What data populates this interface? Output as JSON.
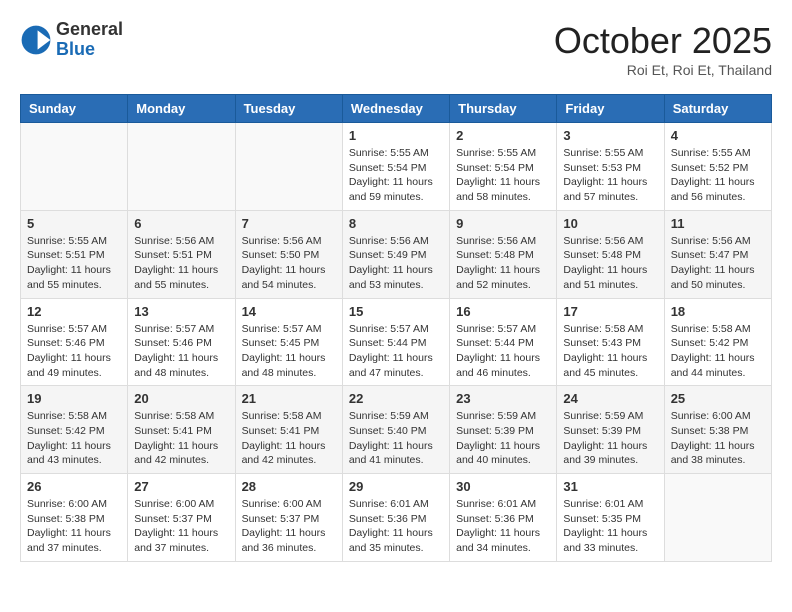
{
  "header": {
    "logo_general": "General",
    "logo_blue": "Blue",
    "month_title": "October 2025",
    "location": "Roi Et, Roi Et, Thailand"
  },
  "weekdays": [
    "Sunday",
    "Monday",
    "Tuesday",
    "Wednesday",
    "Thursday",
    "Friday",
    "Saturday"
  ],
  "weeks": [
    [
      {
        "day": "",
        "info": ""
      },
      {
        "day": "",
        "info": ""
      },
      {
        "day": "",
        "info": ""
      },
      {
        "day": "1",
        "info": "Sunrise: 5:55 AM\nSunset: 5:54 PM\nDaylight: 11 hours\nand 59 minutes."
      },
      {
        "day": "2",
        "info": "Sunrise: 5:55 AM\nSunset: 5:54 PM\nDaylight: 11 hours\nand 58 minutes."
      },
      {
        "day": "3",
        "info": "Sunrise: 5:55 AM\nSunset: 5:53 PM\nDaylight: 11 hours\nand 57 minutes."
      },
      {
        "day": "4",
        "info": "Sunrise: 5:55 AM\nSunset: 5:52 PM\nDaylight: 11 hours\nand 56 minutes."
      }
    ],
    [
      {
        "day": "5",
        "info": "Sunrise: 5:55 AM\nSunset: 5:51 PM\nDaylight: 11 hours\nand 55 minutes."
      },
      {
        "day": "6",
        "info": "Sunrise: 5:56 AM\nSunset: 5:51 PM\nDaylight: 11 hours\nand 55 minutes."
      },
      {
        "day": "7",
        "info": "Sunrise: 5:56 AM\nSunset: 5:50 PM\nDaylight: 11 hours\nand 54 minutes."
      },
      {
        "day": "8",
        "info": "Sunrise: 5:56 AM\nSunset: 5:49 PM\nDaylight: 11 hours\nand 53 minutes."
      },
      {
        "day": "9",
        "info": "Sunrise: 5:56 AM\nSunset: 5:48 PM\nDaylight: 11 hours\nand 52 minutes."
      },
      {
        "day": "10",
        "info": "Sunrise: 5:56 AM\nSunset: 5:48 PM\nDaylight: 11 hours\nand 51 minutes."
      },
      {
        "day": "11",
        "info": "Sunrise: 5:56 AM\nSunset: 5:47 PM\nDaylight: 11 hours\nand 50 minutes."
      }
    ],
    [
      {
        "day": "12",
        "info": "Sunrise: 5:57 AM\nSunset: 5:46 PM\nDaylight: 11 hours\nand 49 minutes."
      },
      {
        "day": "13",
        "info": "Sunrise: 5:57 AM\nSunset: 5:46 PM\nDaylight: 11 hours\nand 48 minutes."
      },
      {
        "day": "14",
        "info": "Sunrise: 5:57 AM\nSunset: 5:45 PM\nDaylight: 11 hours\nand 48 minutes."
      },
      {
        "day": "15",
        "info": "Sunrise: 5:57 AM\nSunset: 5:44 PM\nDaylight: 11 hours\nand 47 minutes."
      },
      {
        "day": "16",
        "info": "Sunrise: 5:57 AM\nSunset: 5:44 PM\nDaylight: 11 hours\nand 46 minutes."
      },
      {
        "day": "17",
        "info": "Sunrise: 5:58 AM\nSunset: 5:43 PM\nDaylight: 11 hours\nand 45 minutes."
      },
      {
        "day": "18",
        "info": "Sunrise: 5:58 AM\nSunset: 5:42 PM\nDaylight: 11 hours\nand 44 minutes."
      }
    ],
    [
      {
        "day": "19",
        "info": "Sunrise: 5:58 AM\nSunset: 5:42 PM\nDaylight: 11 hours\nand 43 minutes."
      },
      {
        "day": "20",
        "info": "Sunrise: 5:58 AM\nSunset: 5:41 PM\nDaylight: 11 hours\nand 42 minutes."
      },
      {
        "day": "21",
        "info": "Sunrise: 5:58 AM\nSunset: 5:41 PM\nDaylight: 11 hours\nand 42 minutes."
      },
      {
        "day": "22",
        "info": "Sunrise: 5:59 AM\nSunset: 5:40 PM\nDaylight: 11 hours\nand 41 minutes."
      },
      {
        "day": "23",
        "info": "Sunrise: 5:59 AM\nSunset: 5:39 PM\nDaylight: 11 hours\nand 40 minutes."
      },
      {
        "day": "24",
        "info": "Sunrise: 5:59 AM\nSunset: 5:39 PM\nDaylight: 11 hours\nand 39 minutes."
      },
      {
        "day": "25",
        "info": "Sunrise: 6:00 AM\nSunset: 5:38 PM\nDaylight: 11 hours\nand 38 minutes."
      }
    ],
    [
      {
        "day": "26",
        "info": "Sunrise: 6:00 AM\nSunset: 5:38 PM\nDaylight: 11 hours\nand 37 minutes."
      },
      {
        "day": "27",
        "info": "Sunrise: 6:00 AM\nSunset: 5:37 PM\nDaylight: 11 hours\nand 37 minutes."
      },
      {
        "day": "28",
        "info": "Sunrise: 6:00 AM\nSunset: 5:37 PM\nDaylight: 11 hours\nand 36 minutes."
      },
      {
        "day": "29",
        "info": "Sunrise: 6:01 AM\nSunset: 5:36 PM\nDaylight: 11 hours\nand 35 minutes."
      },
      {
        "day": "30",
        "info": "Sunrise: 6:01 AM\nSunset: 5:36 PM\nDaylight: 11 hours\nand 34 minutes."
      },
      {
        "day": "31",
        "info": "Sunrise: 6:01 AM\nSunset: 5:35 PM\nDaylight: 11 hours\nand 33 minutes."
      },
      {
        "day": "",
        "info": ""
      }
    ]
  ]
}
